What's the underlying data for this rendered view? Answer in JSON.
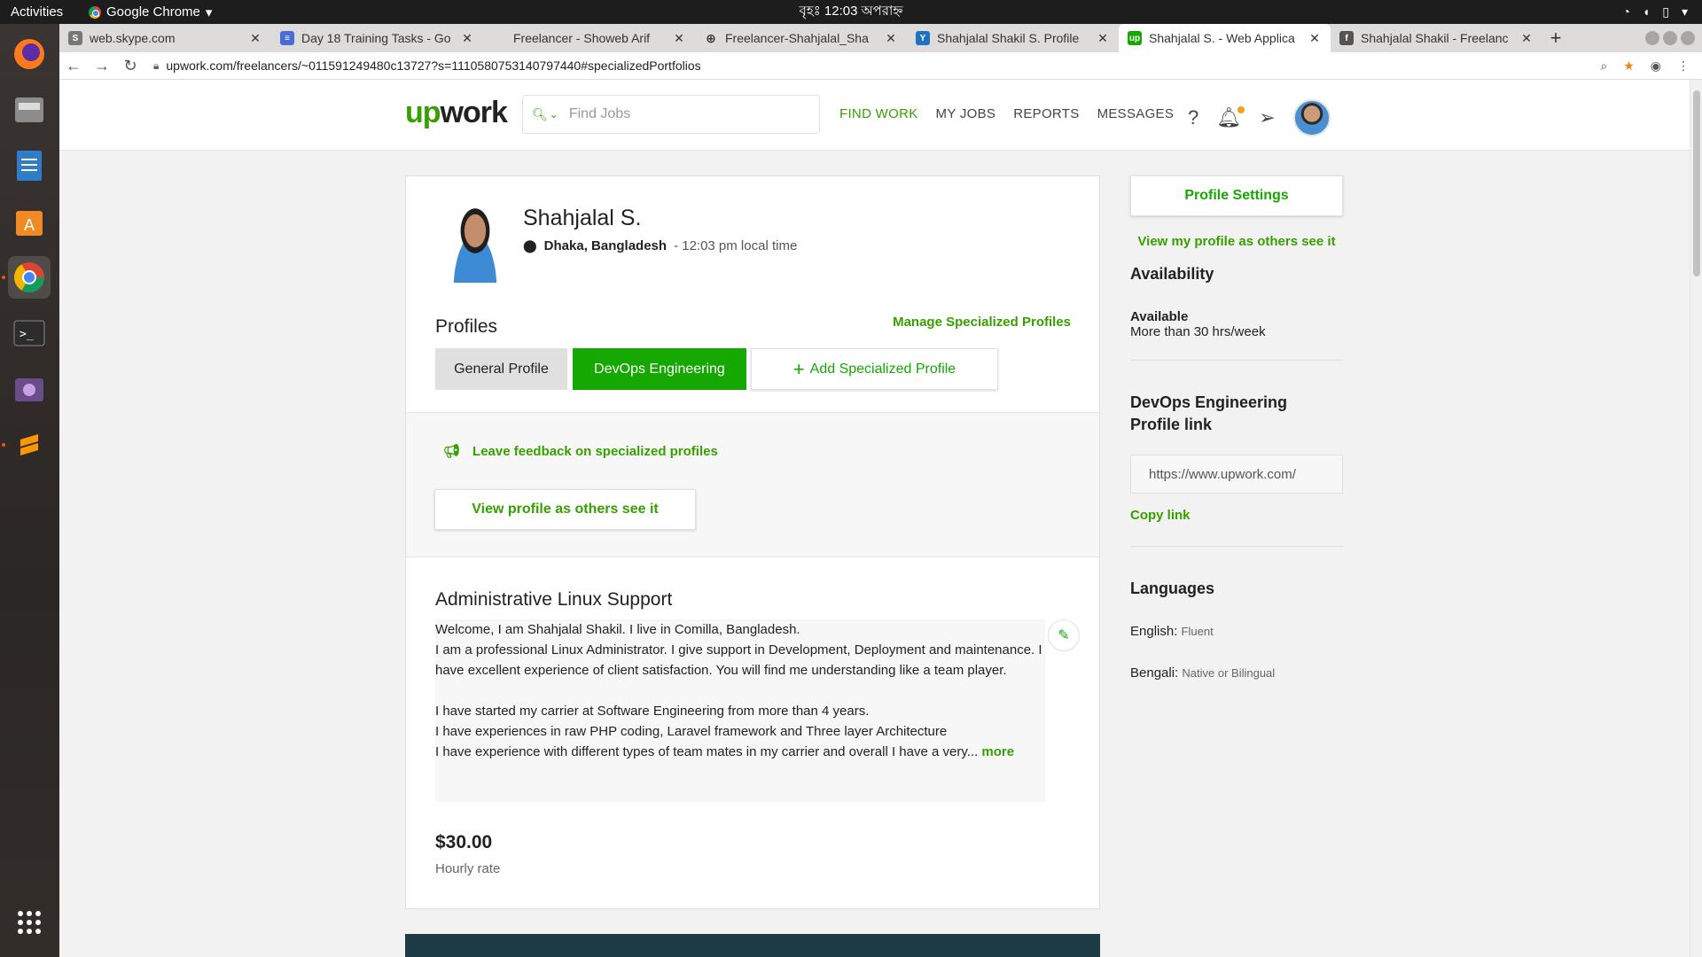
{
  "os": {
    "activities": "Activities",
    "app_name": "Google Chrome",
    "clock": "বৃহঃ 12:03 অপরাহ্ন"
  },
  "browser": {
    "tabs": [
      {
        "title": "web.skype.com",
        "favicon": "skype-icon",
        "active": false
      },
      {
        "title": "Day 18 Training Tasks - Go",
        "favicon": "docs-icon",
        "active": false
      },
      {
        "title": "Freelancer - Showeb Arif",
        "favicon": "none",
        "active": false
      },
      {
        "title": "Freelancer-Shahjalal_Sha",
        "favicon": "globe-icon",
        "active": false
      },
      {
        "title": "Shahjalal Shakil S. Profile",
        "favicon": "y-icon",
        "active": false
      },
      {
        "title": "Shahjalal S. - Web Applica",
        "favicon": "upwork-icon",
        "active": true
      },
      {
        "title": "Shahjalal Shakil - Freelanc",
        "favicon": "freelancer-icon",
        "active": false
      }
    ],
    "url": "upwork.com/freelancers/~011591249480c13727?s=1110580753140797440#specializedPortfolios"
  },
  "header": {
    "logo_up": "up",
    "logo_rest": "work",
    "search_placeholder": "Find Jobs",
    "nav": [
      "FIND WORK",
      "MY JOBS",
      "REPORTS",
      "MESSAGES"
    ]
  },
  "profile": {
    "name": "Shahjalal S.",
    "location": "Dhaka, Bangladesh",
    "local_time": " - 12:03 pm local time",
    "profiles_heading": "Profiles",
    "manage_link": "Manage Specialized Profiles",
    "tab_general": "General Profile",
    "tab_devops": "DevOps Engineering",
    "tab_add": "Add Specialized Profile",
    "feedback_link": "Leave feedback on specialized profiles",
    "view_button": "View profile as others see it",
    "service_title": "Administrative Linux Support",
    "overview_lines": [
      "Welcome, I am Shahjalal Shakil. I live in Comilla, Bangladesh.",
      "I am a professional Linux Administrator. I give support in Development, Deployment and maintenance. I have excellent experience of client satisfaction. You will find me understanding like a team player.",
      "",
      "I have started my carrier at Software Engineering from more than 4 years.",
      "I have experiences in raw PHP coding, Laravel framework and Three layer Architecture",
      "I have experience with different types of team mates in my carrier and overall I have a very..."
    ],
    "more_link": "more",
    "rate": "$30.00",
    "rate_label": "Hourly rate"
  },
  "sidebar": {
    "settings_button": "Profile Settings",
    "view_link": "View my profile as others see it",
    "availability_h": "Availability",
    "available_label": "Available",
    "available_hours": "More than 30 hrs/week",
    "profile_link_h": "DevOps Engineering Profile link",
    "profile_link_value": "https://www.upwork.com/",
    "copy_link": "Copy link",
    "languages_h": "Languages",
    "languages": [
      {
        "name": "English:",
        "level": "Fluent"
      },
      {
        "name": "Bengali:",
        "level": "Native or Bilingual"
      }
    ]
  },
  "colors": {
    "upwork_green": "#14a800",
    "link_green": "#37a000"
  }
}
